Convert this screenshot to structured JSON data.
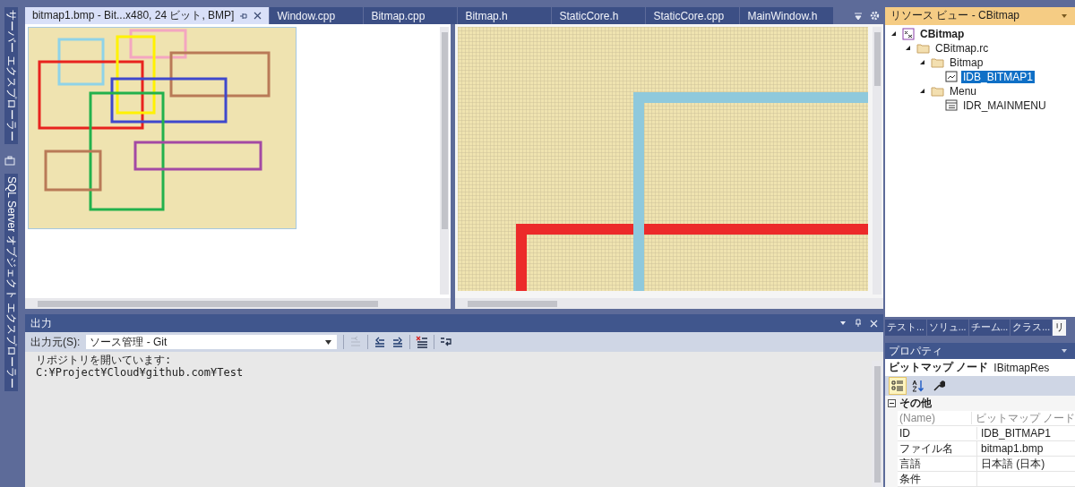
{
  "side_tabs": [
    {
      "label": "サーバー エクスプローラー"
    },
    {
      "label": "SQL Server オブジェクト エクスプローラー"
    }
  ],
  "editor_tabs": [
    {
      "label": "bitmap1.bmp - Bit...x480, 24 ビット, BMP]",
      "selected": true
    },
    {
      "label": "Window.cpp",
      "selected": false
    },
    {
      "label": "Bitmap.cpp",
      "selected": false
    },
    {
      "label": "Bitmap.h",
      "selected": false
    },
    {
      "label": "StaticCore.h",
      "selected": false
    },
    {
      "label": "StaticCore.cpp",
      "selected": false
    },
    {
      "label": "MainWindow.h",
      "selected": false
    }
  ],
  "output": {
    "title": "出力",
    "source_label": "出力元(S):",
    "source": "ソース管理 - Git",
    "lines": [
      "リポジトリを開いています:",
      "C:¥Project¥Cloud¥github.com¥Test"
    ]
  },
  "resource_view": {
    "title": "リソース ビュー - CBitmap",
    "tree": [
      {
        "label": "CBitmap",
        "kind": "project",
        "expanded": true,
        "selected": false,
        "children": [
          {
            "label": "CBitmap.rc",
            "kind": "folder",
            "expanded": true,
            "selected": false,
            "children": [
              {
                "label": "Bitmap",
                "kind": "folder",
                "expanded": true,
                "selected": false,
                "children": [
                  {
                    "label": "IDB_BITMAP1",
                    "kind": "bitmap",
                    "selected": true
                  }
                ]
              },
              {
                "label": "Menu",
                "kind": "folder",
                "expanded": true,
                "selected": false,
                "children": [
                  {
                    "label": "IDR_MAINMENU",
                    "kind": "menu",
                    "selected": false
                  }
                ]
              }
            ]
          }
        ]
      }
    ]
  },
  "panel_tabs": [
    {
      "label": "テスト...",
      "selected": false
    },
    {
      "label": "ソリュ...",
      "selected": false
    },
    {
      "label": "チーム...",
      "selected": false
    },
    {
      "label": "クラス...",
      "selected": false
    },
    {
      "label": "リ",
      "selected": true
    }
  ],
  "properties": {
    "title": "プロパティ",
    "object": "ビットマップ ノード",
    "object_type": "IBitmapRes",
    "toolbar": [
      {
        "kind": "categorized",
        "selected": true
      },
      {
        "kind": "alphabetical",
        "selected": false
      },
      {
        "kind": "pages",
        "selected": false
      }
    ],
    "category": "その他",
    "rows": [
      {
        "name": "(Name)",
        "value": "ビットマップ ノード",
        "greyed": true
      },
      {
        "name": "ID",
        "value": "IDB_BITMAP1",
        "greyed": false
      },
      {
        "name": "ファイル名",
        "value": "bitmap1.bmp",
        "greyed": false
      },
      {
        "name": "言語",
        "value": "日本語 (日本)",
        "greyed": false
      },
      {
        "name": "条件",
        "greyed": false
      }
    ]
  }
}
